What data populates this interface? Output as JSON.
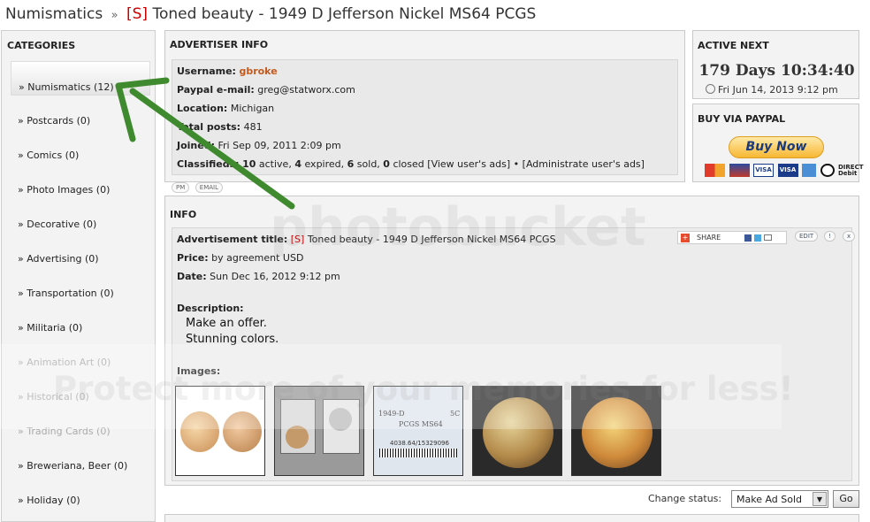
{
  "breadcrumb": {
    "parent": "Numismatics",
    "separator": "»",
    "tag": "[S]",
    "title": "Toned beauty - 1949 D Jefferson Nickel MS64 PCGS"
  },
  "categories": {
    "heading": "CATEGORIES",
    "items": [
      {
        "label": "» Numismatics (12)"
      },
      {
        "label": "» Postcards (0)"
      },
      {
        "label": "» Comics (0)"
      },
      {
        "label": "» Photo Images (0)"
      },
      {
        "label": "» Decorative (0)"
      },
      {
        "label": "» Advertising (0)"
      },
      {
        "label": "» Transportation (0)"
      },
      {
        "label": "» Militaria (0)"
      },
      {
        "label": "» Animation Art (0)"
      },
      {
        "label": "» Historical (0)"
      },
      {
        "label": "» Trading Cards (0)"
      },
      {
        "label": "» Breweriana, Beer (0)"
      },
      {
        "label": "» Holiday (0)"
      }
    ]
  },
  "advertiser": {
    "heading": "ADVERTISER INFO",
    "username_label": "Username:",
    "username": "gbroke",
    "paypal_label": "Paypal e-mail:",
    "paypal": "greg@statworx.com",
    "location_label": "Location:",
    "location": "Michigan",
    "posts_label": "Total posts:",
    "posts": "481",
    "joined_label": "Joined:",
    "joined": "Fri Sep 09, 2011 2:09 pm",
    "classifieds_label": "Classifieds:",
    "active_n": "10",
    "active_t": "active,",
    "expired_n": "4",
    "expired_t": "expired,",
    "sold_n": "6",
    "sold_t": "sold,",
    "closed_n": "0",
    "closed_t": "closed",
    "view_link": "[View user's ads]",
    "bullet": "•",
    "admin_link": "[Administrate user's ads]",
    "pm_label": "PM",
    "email_label": "EMAIL"
  },
  "active_next": {
    "heading": "ACTIVE NEXT",
    "countdown": "179 Days 10:34:40",
    "date": "Fri Jun 14, 2013 9:12 pm"
  },
  "paypal_box": {
    "heading": "BUY VIA PAYPAL",
    "button": "Buy Now",
    "debit_1": "DIRECT",
    "debit_2": "Debit"
  },
  "info": {
    "heading": "INFO",
    "title_label": "Advertisement title:",
    "title_tag": "[S]",
    "title_value": "Toned beauty - 1949 D Jefferson Nickel MS64 PCGS",
    "price_label": "Price:",
    "price_value": "by agreement USD",
    "date_label": "Date:",
    "date_value": "Sun Dec 16, 2012 9:12 pm",
    "desc_label": "Description:",
    "desc_line1": "Make an offer.",
    "desc_line2": "Stunning colors.",
    "images_label": "Images:",
    "share_label": "SHARE",
    "edit_label": "EDIT",
    "report_label": "!",
    "delete_label": "x",
    "slab_line1": "1949-D",
    "slab_sc": "5C",
    "slab_line2": "PCGS MS64",
    "slab_cert": "4038.64/15329096"
  },
  "status": {
    "label": "Change status:",
    "selected": "Make Ad Sold",
    "go": "Go"
  },
  "watermark": {
    "brand": "photobucket",
    "protect": "Protect more of your memories for less!"
  },
  "colors": {
    "accent_red": "#cc0000",
    "username_orange": "#c35a1d",
    "arrow_green": "#3f8a2e",
    "paypal_gold": "#f7b733"
  }
}
